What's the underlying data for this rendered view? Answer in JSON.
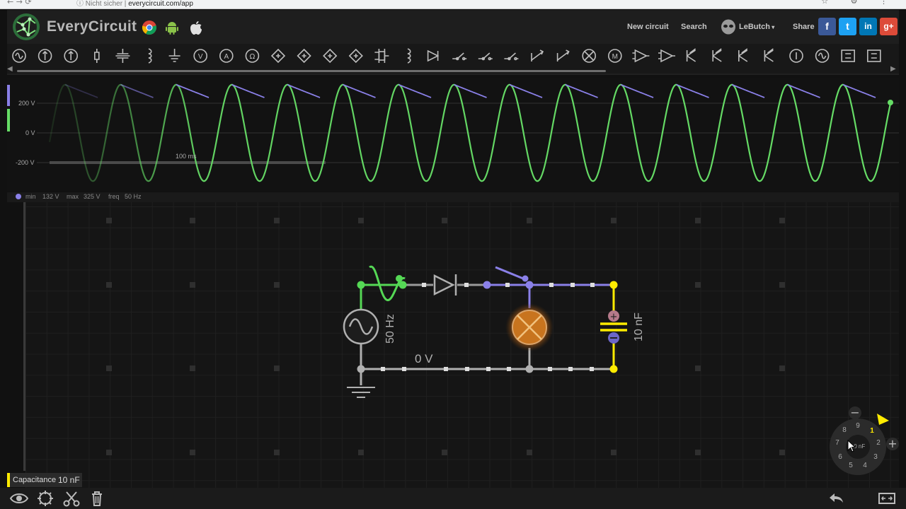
{
  "browser": {
    "security": "Nicht sicher",
    "url": "everycircuit.com/app"
  },
  "header": {
    "app_name": "EveryCircuit",
    "platforms": [
      "chrome-icon",
      "android-icon",
      "apple-icon"
    ],
    "new_circuit": "New circuit",
    "search": "Search",
    "user": "LeButch",
    "share": "Share",
    "social": [
      {
        "name": "facebook",
        "glyph": "f",
        "color": "#3b5998"
      },
      {
        "name": "twitter",
        "glyph": "t",
        "color": "#1da1f2"
      },
      {
        "name": "linkedin",
        "glyph": "in",
        "color": "#0077b5"
      },
      {
        "name": "google-plus",
        "glyph": "g+",
        "color": "#dd4b39"
      }
    ]
  },
  "toolbar": {
    "components": [
      "ac-source-icon",
      "dc-current-icon",
      "current-source-icon",
      "battery-icon",
      "capacitor-icon",
      "inductor-icon",
      "ground-icon",
      "voltmeter-icon",
      "ammeter-icon",
      "ohmmeter-icon",
      "dep-source-1-icon",
      "dep-source-2-icon",
      "dep-source-3-icon",
      "dep-source-4-icon",
      "transformer-icon",
      "coupled-inductor-icon",
      "diode-icon",
      "switch-spst-icon",
      "switch-spdt-icon",
      "pushbutton-icon",
      "relay-icon",
      "potentiometer-icon",
      "lamp-icon",
      "motor-icon",
      "opamp-icon",
      "comparator-icon",
      "npn-icon",
      "pnp-icon",
      "nmos-icon",
      "pmos-icon",
      "logic-probe-icon",
      "clock-icon",
      "logic-gate-icon",
      "more-icon"
    ]
  },
  "scope": {
    "labels": [
      "200 V",
      "0 V",
      "-200 V"
    ],
    "time_scale": "100 ms",
    "info": {
      "min_label": "min",
      "min": "132 V",
      "max_label": "max",
      "max": "325 V",
      "freq_label": "freq",
      "freq": "50 Hz"
    },
    "colors": {
      "source": "#66dd66",
      "capacitor": "#8a80e8"
    }
  },
  "circuit": {
    "source_label": "50 Hz",
    "node_label": "0 V",
    "cap_label": "10 nF",
    "colors": {
      "source_wire": "#55d855",
      "node_wire": "#8a80e8",
      "cap_wire": "#ffeb00",
      "ground_wire": "#b0b0b0",
      "lamp": "#c8741e"
    }
  },
  "selected": {
    "property": "Capacitance",
    "value": "10 nF"
  },
  "dial": {
    "numbers": [
      "1",
      "2",
      "3",
      "4",
      "5",
      "6",
      "7",
      "8",
      "9"
    ],
    "center": "10 nF",
    "minus": "−",
    "plus": "+"
  }
}
